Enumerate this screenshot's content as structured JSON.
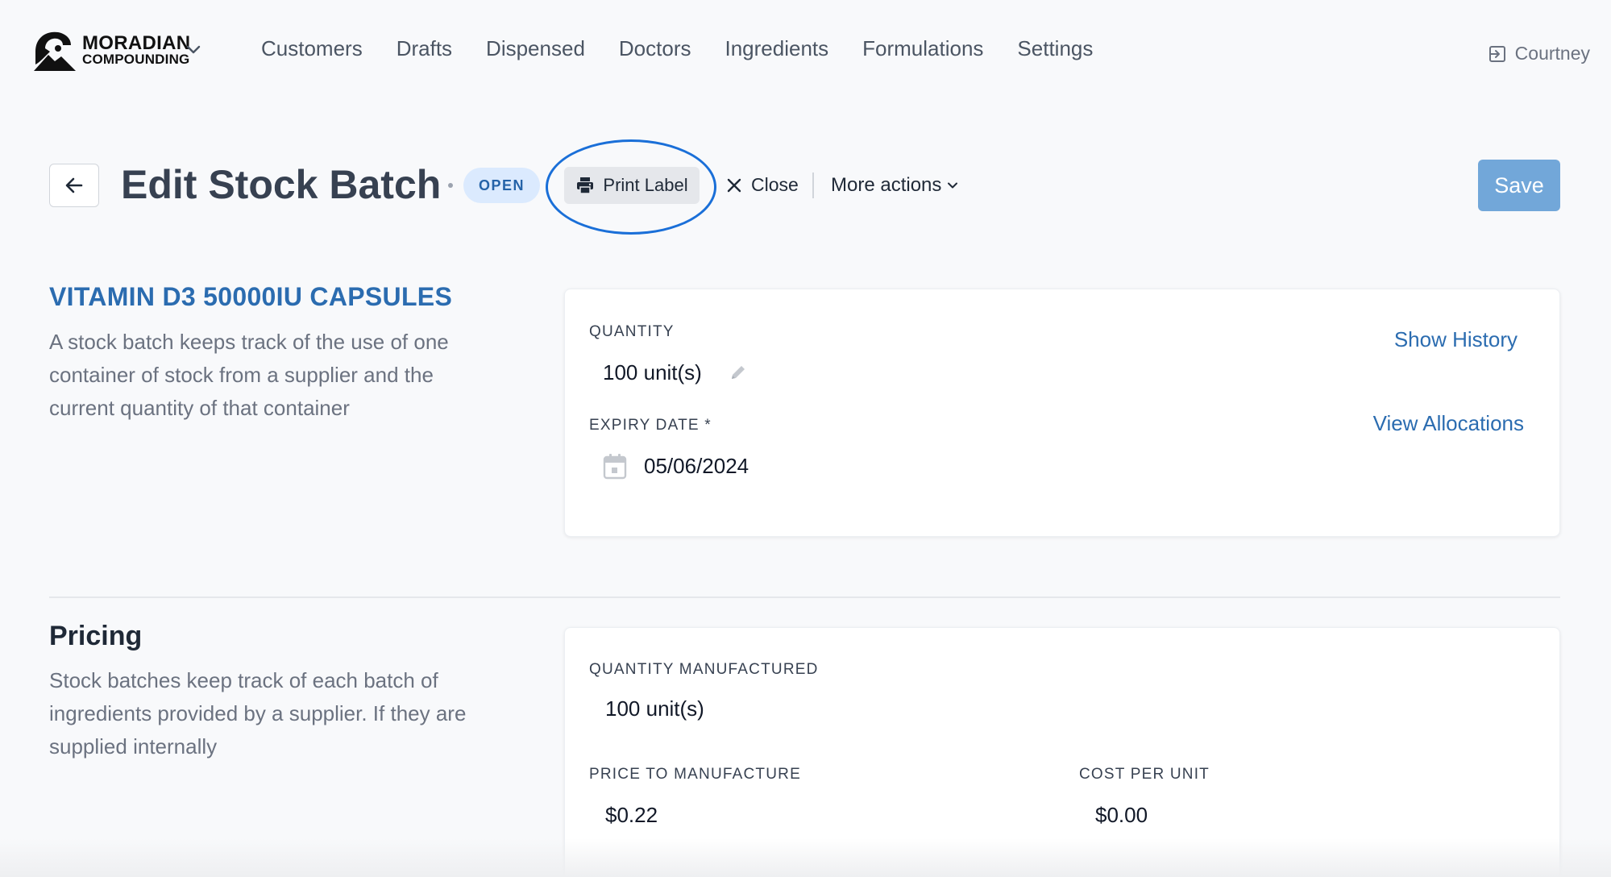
{
  "brand": {
    "logo_line1": "MORADIAN",
    "logo_line2": "COMPOUNDING",
    "logo_icon": "brand-logo-icon",
    "caret_icon": "chevron-down-icon"
  },
  "nav": {
    "items": [
      {
        "label": "Customers"
      },
      {
        "label": "Drafts"
      },
      {
        "label": "Dispensed"
      },
      {
        "label": "Doctors"
      },
      {
        "label": "Ingredients"
      },
      {
        "label": "Formulations"
      },
      {
        "label": "Settings"
      }
    ]
  },
  "user": {
    "name": "Courtney",
    "icon": "logout-icon"
  },
  "header": {
    "title": "Edit Stock Batch",
    "status": "OPEN",
    "print_label": "Print Label",
    "close_label": "Close",
    "more_actions_label": "More actions",
    "save_label": "Save"
  },
  "batch": {
    "product_name": "VITAMIN D3 50000IU CAPSULES",
    "description": "A stock batch keeps track of the use of one container of stock from a supplier and the current quantity of that container",
    "quantity_label": "QUANTITY",
    "quantity_value": "100 unit(s)",
    "expiry_label": "EXPIRY DATE *",
    "expiry_value": "05/06/2024",
    "show_history": "Show History",
    "view_allocations": "View Allocations"
  },
  "pricing": {
    "title": "Pricing",
    "description": "Stock batches keep track of each batch of ingredients provided by a supplier. If they are supplied internally",
    "qty_manufactured_label": "QUANTITY MANUFACTURED",
    "qty_manufactured_value": "100 unit(s)",
    "price_to_manufacture_label": "PRICE TO MANUFACTURE",
    "price_to_manufacture_value": "$0.22",
    "cost_per_unit_label": "COST PER UNIT",
    "cost_per_unit_value": "$0.00"
  },
  "colors": {
    "accent": "#2b6cb0",
    "save_button": "#72a7d9",
    "badge_bg": "#dbeafe",
    "highlight_ring": "#1a6fd8"
  }
}
